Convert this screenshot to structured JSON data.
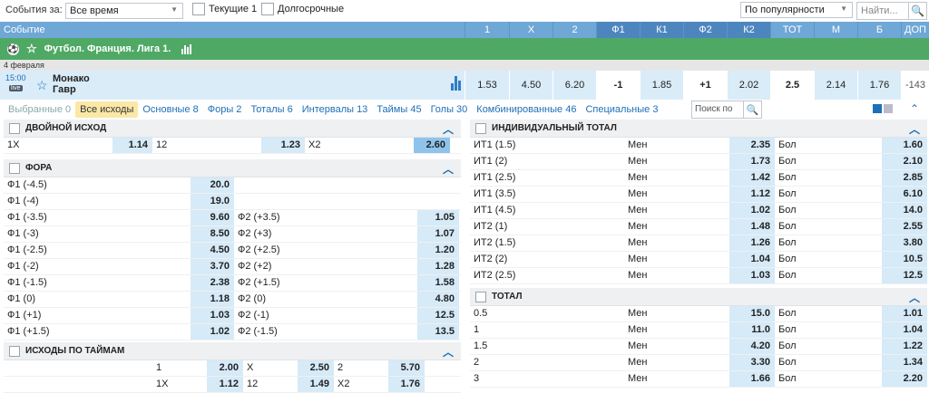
{
  "filter": {
    "label": "События за:",
    "period": "Все время",
    "current": "Текущие 1",
    "longterm": "Долгосрочные",
    "sort": "По популярности",
    "search_placeholder": "Найти..."
  },
  "header": {
    "event": "Событие",
    "cols": [
      "1",
      "X",
      "2",
      "Ф1",
      "К1",
      "Ф2",
      "К2",
      "ТОТ",
      "М",
      "Б",
      "ДОП"
    ]
  },
  "league": {
    "name": "Футбол. Франция. Лига 1."
  },
  "date": "4 февраля",
  "match": {
    "time": "15:00",
    "live": "live",
    "team1": "Монако",
    "team2": "Гавр",
    "odds": [
      "1.53",
      "4.50",
      "6.20",
      "-1",
      "1.85",
      "+1",
      "2.02",
      "2.5",
      "2.14",
      "1.76",
      "-143"
    ]
  },
  "tabs": [
    {
      "label": "Выбранные 0"
    },
    {
      "label": "Все исходы"
    },
    {
      "label": "Основные 8"
    },
    {
      "label": "Форы 2"
    },
    {
      "label": "Тоталы 6"
    },
    {
      "label": "Интервалы 13"
    },
    {
      "label": "Таймы 45"
    },
    {
      "label": "Голы 30"
    },
    {
      "label": "Комбинированные 46"
    },
    {
      "label": "Специальные 3"
    }
  ],
  "tab_search": "Поиск по",
  "double": {
    "title": "ДВОЙНОЙ ИСХОД",
    "items": [
      {
        "n": "1X",
        "v": "1.14"
      },
      {
        "n": "12",
        "v": "1.23"
      },
      {
        "n": "X2",
        "v": "2.60"
      }
    ]
  },
  "fora": {
    "title": "ФОРА",
    "rows": [
      {
        "n1": "Ф1 (-4.5)",
        "v1": "20.0",
        "n2": "",
        "v2": ""
      },
      {
        "n1": "Ф1 (-4)",
        "v1": "19.0",
        "n2": "",
        "v2": ""
      },
      {
        "n1": "Ф1 (-3.5)",
        "v1": "9.60",
        "n2": "Ф2 (+3.5)",
        "v2": "1.05"
      },
      {
        "n1": "Ф1 (-3)",
        "v1": "8.50",
        "n2": "Ф2 (+3)",
        "v2": "1.07"
      },
      {
        "n1": "Ф1 (-2.5)",
        "v1": "4.50",
        "n2": "Ф2 (+2.5)",
        "v2": "1.20"
      },
      {
        "n1": "Ф1 (-2)",
        "v1": "3.70",
        "n2": "Ф2 (+2)",
        "v2": "1.28"
      },
      {
        "n1": "Ф1 (-1.5)",
        "v1": "2.38",
        "n2": "Ф2 (+1.5)",
        "v2": "1.58"
      },
      {
        "n1": "Ф1 (0)",
        "v1": "1.18",
        "n2": "Ф2 (0)",
        "v2": "4.80"
      },
      {
        "n1": "Ф1 (+1)",
        "v1": "1.03",
        "n2": "Ф2 (-1)",
        "v2": "12.5"
      },
      {
        "n1": "Ф1 (+1.5)",
        "v1": "1.02",
        "n2": "Ф2 (-1.5)",
        "v2": "13.5"
      }
    ]
  },
  "halves": {
    "title": "ИСХОДЫ ПО ТАЙМАМ",
    "rows": [
      {
        "a": "1",
        "av": "2.00",
        "b": "X",
        "bv": "2.50",
        "c": "2",
        "cv": "5.70"
      },
      {
        "a": "1X",
        "av": "1.12",
        "b": "12",
        "bv": "1.49",
        "c": "X2",
        "cv": "1.76"
      }
    ]
  },
  "indiv": {
    "title": "ИНДИВИДУАЛЬНЫЙ ТОТАЛ",
    "rows": [
      {
        "n": "ИТ1 (1.5)",
        "m": "Мен",
        "mv": "2.35",
        "b": "Бол",
        "bv": "1.60"
      },
      {
        "n": "ИТ1 (2)",
        "m": "Мен",
        "mv": "1.73",
        "b": "Бол",
        "bv": "2.10"
      },
      {
        "n": "ИТ1 (2.5)",
        "m": "Мен",
        "mv": "1.42",
        "b": "Бол",
        "bv": "2.85"
      },
      {
        "n": "ИТ1 (3.5)",
        "m": "Мен",
        "mv": "1.12",
        "b": "Бол",
        "bv": "6.10"
      },
      {
        "n": "ИТ1 (4.5)",
        "m": "Мен",
        "mv": "1.02",
        "b": "Бол",
        "bv": "14.0"
      },
      {
        "n": "ИТ2 (1)",
        "m": "Мен",
        "mv": "1.48",
        "b": "Бол",
        "bv": "2.55"
      },
      {
        "n": "ИТ2 (1.5)",
        "m": "Мен",
        "mv": "1.26",
        "b": "Бол",
        "bv": "3.80"
      },
      {
        "n": "ИТ2 (2)",
        "m": "Мен",
        "mv": "1.04",
        "b": "Бол",
        "bv": "10.5"
      },
      {
        "n": "ИТ2 (2.5)",
        "m": "Мен",
        "mv": "1.03",
        "b": "Бол",
        "bv": "12.5"
      }
    ]
  },
  "total": {
    "title": "ТОТАЛ",
    "rows": [
      {
        "n": "0.5",
        "m": "Мен",
        "mv": "15.0",
        "b": "Бол",
        "bv": "1.01"
      },
      {
        "n": "1",
        "m": "Мен",
        "mv": "11.0",
        "b": "Бол",
        "bv": "1.04"
      },
      {
        "n": "1.5",
        "m": "Мен",
        "mv": "4.20",
        "b": "Бол",
        "bv": "1.22"
      },
      {
        "n": "2",
        "m": "Мен",
        "mv": "3.30",
        "b": "Бол",
        "bv": "1.34"
      },
      {
        "n": "3",
        "m": "Мен",
        "mv": "1.66",
        "b": "Бол",
        "bv": "2.20"
      }
    ]
  }
}
